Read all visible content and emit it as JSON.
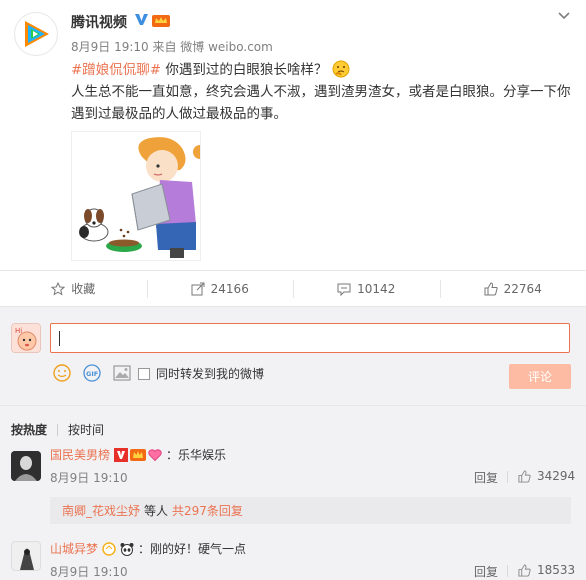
{
  "post": {
    "author": "腾讯视频",
    "meta": "8月9日 19:10 来自 微博 weibo.com",
    "topic": "#蹭娘侃侃聊#",
    "headline": "你遇到过的白眼狼长啥样？",
    "body": "人生总不能一直如意，终究会遇人不淑，遇到渣男渣女，或者是白眼狼。分享一下你遇到过最极品的人做过最极品的事。",
    "icons": {
      "avatar": "tencent-video-logo",
      "verify": "verified-v-icon",
      "vip": "vip-crown-icon",
      "menu": "chevron-down-icon",
      "emoji": "thinking-emoji",
      "image": "girl-feeding-dog-illustration"
    }
  },
  "actions": {
    "favorite_label": "收藏",
    "repost_count": "24166",
    "comment_count": "10142",
    "like_count": "22764"
  },
  "composer": {
    "repost_label": "同时转发到我的微博",
    "submit_label": "评论"
  },
  "sort": {
    "hot": "按热度",
    "time": "按时间"
  },
  "comments": [
    {
      "user": "国民美男榜",
      "text": "：乐华娱乐",
      "time": "8月9日 19:10",
      "reply_label": "回复",
      "likes": "34294",
      "sub": {
        "name": "南卿_花戏尘妤",
        "mid": "等人",
        "count": "共297条回复"
      }
    },
    {
      "user": "山城异梦",
      "text": "：刚的好！硬气一点",
      "time": "8月9日 19:10",
      "reply_label": "回复",
      "likes": "18533"
    }
  ],
  "colors": {
    "accent": "#eb7350",
    "muted": "#808080",
    "panel": "#f2f2f5",
    "submit_disabled": "#fcbba2"
  }
}
